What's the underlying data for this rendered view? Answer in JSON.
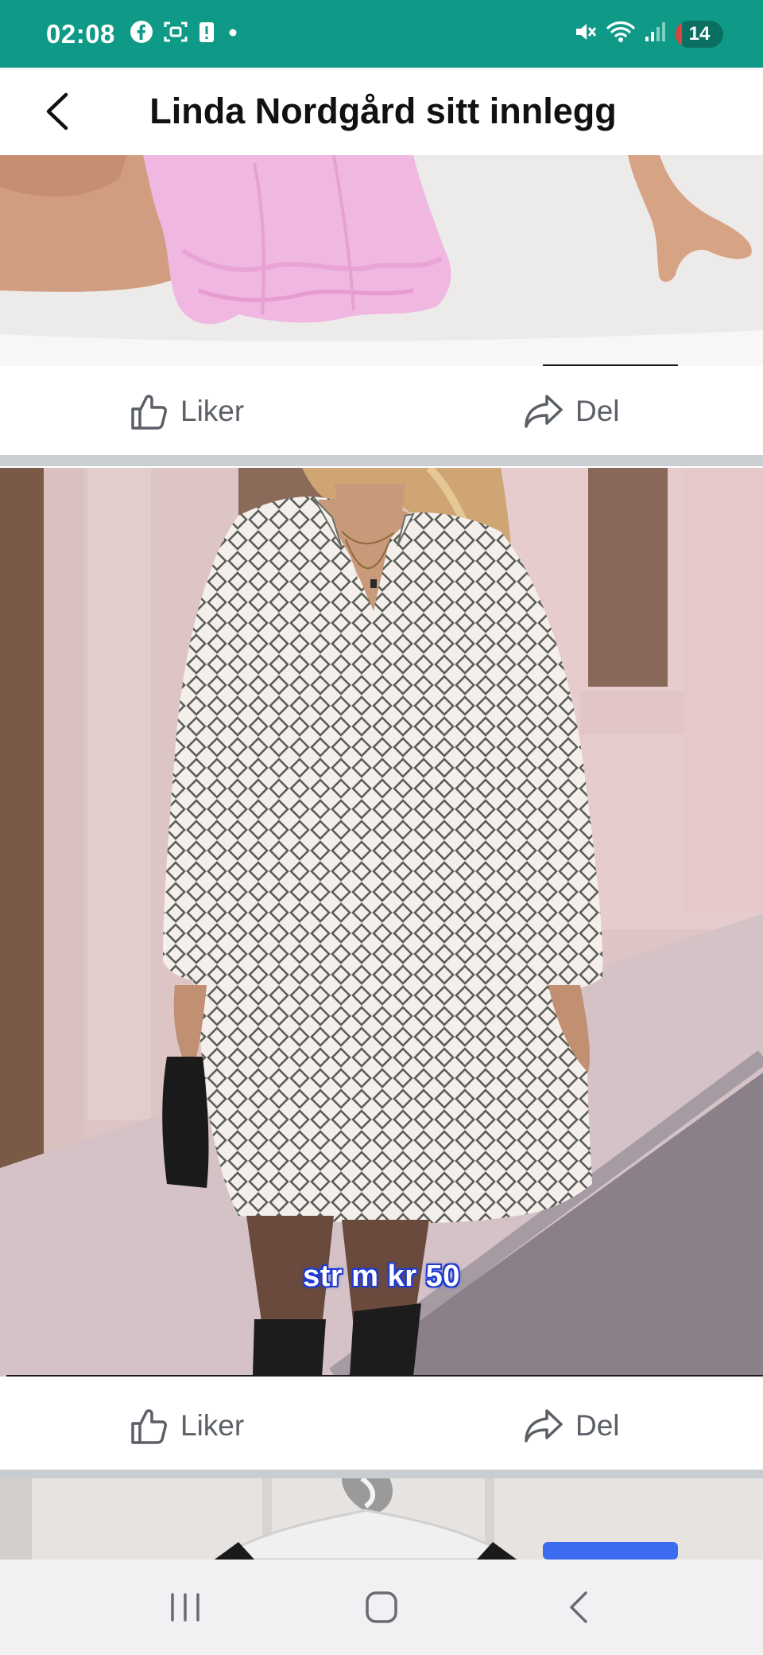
{
  "status_bar": {
    "time": "02:08",
    "battery_percent": "14",
    "battery_level": 0.14,
    "icons": [
      "facebook-icon",
      "screenshot-icon",
      "alert-icon",
      "dot-icon",
      "mute-icon",
      "wifi-icon",
      "signal-icon",
      "battery-icon"
    ]
  },
  "header": {
    "title": "Linda Nordgård sitt innlegg",
    "back_icon": "chevron-left-icon"
  },
  "posts": [
    {
      "like_label": "Liker",
      "share_label": "Del"
    },
    {
      "like_label": "Liker",
      "share_label": "Del",
      "caption": "str m kr 50"
    }
  ],
  "nav_bar": {
    "icons": [
      "recent-apps-icon",
      "home-icon",
      "back-icon"
    ]
  },
  "colors": {
    "status_bar": "#0e9a86",
    "action_text": "#5b5f66",
    "separator": "#c9ccd1",
    "caption_outline": "#1d3bd6",
    "accent_blue": "#3b6cf0"
  }
}
